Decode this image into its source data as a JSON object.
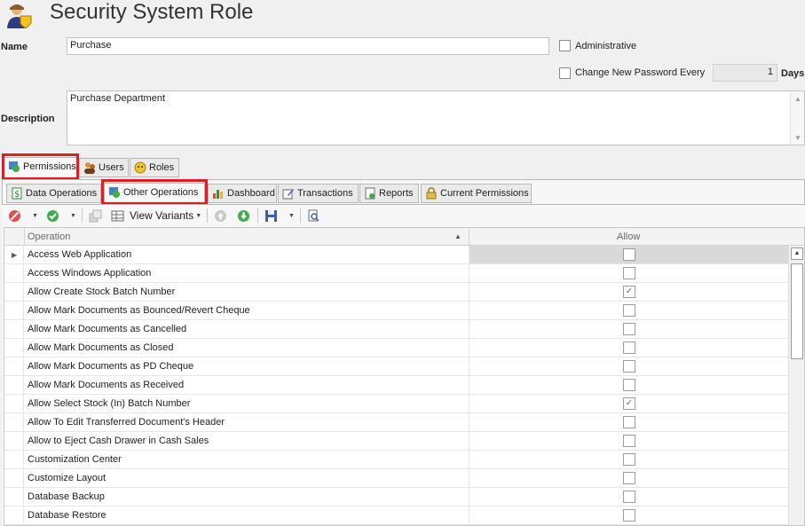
{
  "header": {
    "title": "Security System Role",
    "icon": "user-shield-icon"
  },
  "form": {
    "name_label": "Name",
    "name_value": "Purchase",
    "administrative_label": "Administrative",
    "change_pwd_label": "Change New Password Every",
    "change_pwd_value": "1",
    "days_label": "Days",
    "description_label": "Description",
    "description_value": "Purchase Department"
  },
  "outer_tabs": [
    {
      "label": "Permissions",
      "icon": "permissions-icon",
      "active": true
    },
    {
      "label": "Users",
      "icon": "users-icon",
      "active": false
    },
    {
      "label": "Roles",
      "icon": "roles-icon",
      "active": false
    }
  ],
  "inner_tabs": [
    {
      "label": "Data Operations",
      "icon": "dollar-doc-icon"
    },
    {
      "label": "Other Operations",
      "icon": "permissions-icon",
      "active": true
    },
    {
      "label": "Dashboard",
      "icon": "bar-chart-icon"
    },
    {
      "label": "Transactions",
      "icon": "edit-doc-icon"
    },
    {
      "label": "Reports",
      "icon": "report-icon"
    },
    {
      "label": "Current Permissions",
      "icon": "lock-icon"
    }
  ],
  "toolbar": {
    "view_variants_label": "View Variants"
  },
  "grid": {
    "col_operation": "Operation",
    "col_allow": "Allow",
    "rows": [
      {
        "op": "Access Web Application",
        "allow": false
      },
      {
        "op": "Access Windows Application",
        "allow": false
      },
      {
        "op": "Allow Create Stock Batch Number",
        "allow": true
      },
      {
        "op": "Allow Mark Documents as Bounced/Revert Cheque",
        "allow": false
      },
      {
        "op": "Allow Mark Documents as Cancelled",
        "allow": false
      },
      {
        "op": "Allow Mark Documents as Closed",
        "allow": false
      },
      {
        "op": "Allow Mark Documents as PD Cheque",
        "allow": false
      },
      {
        "op": "Allow Mark Documents as Received",
        "allow": false
      },
      {
        "op": "Allow Select Stock (In) Batch Number",
        "allow": true
      },
      {
        "op": "Allow To Edit Transferred Document's Header",
        "allow": false
      },
      {
        "op": "Allow to Eject Cash Drawer in Cash Sales",
        "allow": false
      },
      {
        "op": "Customization Center",
        "allow": false
      },
      {
        "op": "Customize Layout",
        "allow": false
      },
      {
        "op": "Database Backup",
        "allow": false
      },
      {
        "op": "Database Restore",
        "allow": false
      }
    ]
  },
  "colors": {
    "highlight_red": "#e31b23",
    "focused_cell": "#d9d9d9"
  }
}
